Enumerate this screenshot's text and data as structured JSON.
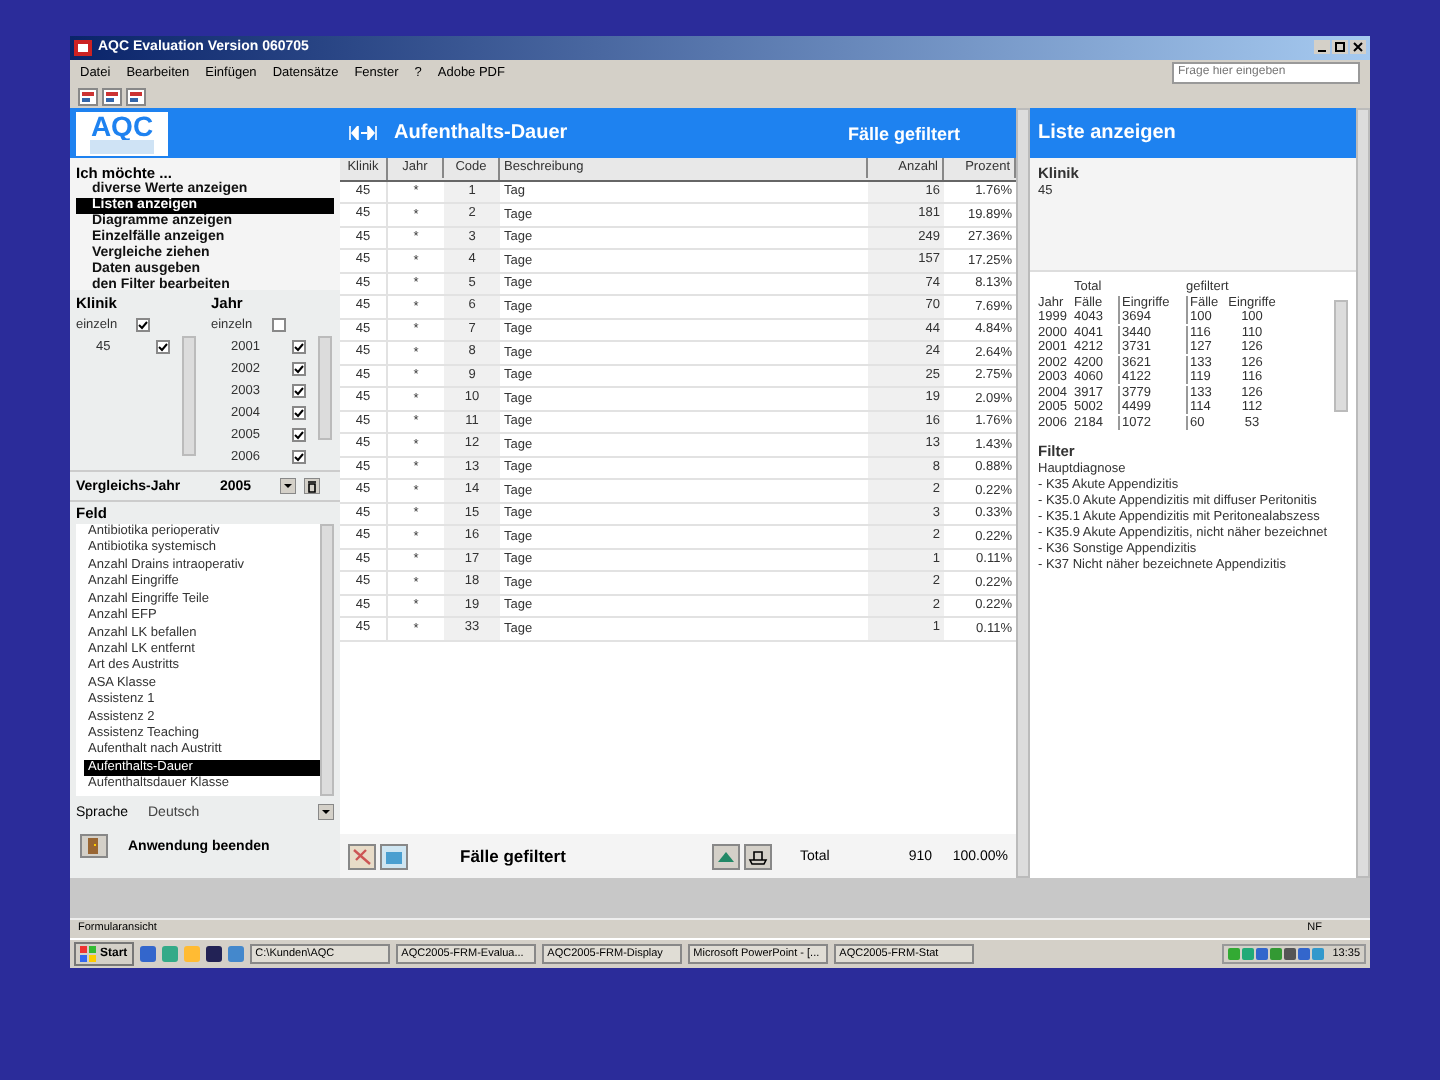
{
  "window": {
    "title": "AQC Evaluation Version 060705",
    "help_placeholder": "Frage hier eingeben"
  },
  "menu": [
    "Datei",
    "Bearbeiten",
    "Einfügen",
    "Datensätze",
    "Fenster",
    "?",
    "Adobe PDF"
  ],
  "left": {
    "logo": "AQC",
    "heading": "Ich möchte ...",
    "actions": [
      {
        "label": "diverse Werte anzeigen",
        "selected": false
      },
      {
        "label": "Listen anzeigen",
        "selected": true
      },
      {
        "label": "Diagramme anzeigen",
        "selected": false
      },
      {
        "label": "Einzelfälle anzeigen",
        "selected": false
      },
      {
        "label": "Vergleiche ziehen",
        "selected": false
      },
      {
        "label": "Daten ausgeben",
        "selected": false
      },
      {
        "label": "den Filter bearbeiten",
        "selected": false
      }
    ],
    "klinik": {
      "label": "Klinik",
      "einzeln_label": "einzeln",
      "einzeln_checked": true,
      "items": [
        {
          "label": "45",
          "checked": true
        }
      ]
    },
    "jahr": {
      "label": "Jahr",
      "einzeln_label": "einzeln",
      "einzeln_checked": false,
      "items": [
        {
          "label": "2001",
          "checked": true
        },
        {
          "label": "2002",
          "checked": true
        },
        {
          "label": "2003",
          "checked": true
        },
        {
          "label": "2004",
          "checked": true
        },
        {
          "label": "2005",
          "checked": true
        },
        {
          "label": "2006",
          "checked": true
        }
      ]
    },
    "vergleichsjahr": {
      "label": "Vergleichs-Jahr",
      "value": "2005"
    },
    "feld": {
      "label": "Feld",
      "items": [
        {
          "label": "Antibiotika perioperativ",
          "selected": false
        },
        {
          "label": "Antibiotika systemisch",
          "selected": false
        },
        {
          "label": "Anzahl Drains intraoperativ",
          "selected": false
        },
        {
          "label": "Anzahl Eingriffe",
          "selected": false
        },
        {
          "label": "Anzahl Eingriffe Teile",
          "selected": false
        },
        {
          "label": "Anzahl EFP",
          "selected": false
        },
        {
          "label": "Anzahl LK befallen",
          "selected": false
        },
        {
          "label": "Anzahl LK entfernt",
          "selected": false
        },
        {
          "label": "Art des Austritts",
          "selected": false
        },
        {
          "label": "ASA Klasse",
          "selected": false
        },
        {
          "label": "Assistenz 1",
          "selected": false
        },
        {
          "label": "Assistenz 2",
          "selected": false
        },
        {
          "label": "Assistenz Teaching",
          "selected": false
        },
        {
          "label": "Aufenthalt nach Austritt",
          "selected": false
        },
        {
          "label": "Aufenthalts-Dauer",
          "selected": true
        },
        {
          "label": "Aufenthaltsdauer Klasse",
          "selected": false
        }
      ]
    },
    "sprache": {
      "label": "Sprache",
      "value": "Deutsch"
    },
    "exit_label": "Anwendung beenden"
  },
  "center": {
    "title": "Aufenthalts-Dauer",
    "subtitle": "Fälle gefiltert",
    "columns": [
      "Klinik",
      "Jahr",
      "Code",
      "Beschreibung",
      "Anzahl",
      "Prozent"
    ],
    "rows": [
      [
        "45",
        "*",
        "1",
        "Tag",
        "16",
        "1.76%"
      ],
      [
        "45",
        "*",
        "2",
        "Tage",
        "181",
        "19.89%"
      ],
      [
        "45",
        "*",
        "3",
        "Tage",
        "249",
        "27.36%"
      ],
      [
        "45",
        "*",
        "4",
        "Tage",
        "157",
        "17.25%"
      ],
      [
        "45",
        "*",
        "5",
        "Tage",
        "74",
        "8.13%"
      ],
      [
        "45",
        "*",
        "6",
        "Tage",
        "70",
        "7.69%"
      ],
      [
        "45",
        "*",
        "7",
        "Tage",
        "44",
        "4.84%"
      ],
      [
        "45",
        "*",
        "8",
        "Tage",
        "24",
        "2.64%"
      ],
      [
        "45",
        "*",
        "9",
        "Tage",
        "25",
        "2.75%"
      ],
      [
        "45",
        "*",
        "10",
        "Tage",
        "19",
        "2.09%"
      ],
      [
        "45",
        "*",
        "11",
        "Tage",
        "16",
        "1.76%"
      ],
      [
        "45",
        "*",
        "12",
        "Tage",
        "13",
        "1.43%"
      ],
      [
        "45",
        "*",
        "13",
        "Tage",
        "8",
        "0.88%"
      ],
      [
        "45",
        "*",
        "14",
        "Tage",
        "2",
        "0.22%"
      ],
      [
        "45",
        "*",
        "15",
        "Tage",
        "3",
        "0.33%"
      ],
      [
        "45",
        "*",
        "16",
        "Tage",
        "2",
        "0.22%"
      ],
      [
        "45",
        "*",
        "17",
        "Tage",
        "1",
        "0.11%"
      ],
      [
        "45",
        "*",
        "18",
        "Tage",
        "2",
        "0.22%"
      ],
      [
        "45",
        "*",
        "19",
        "Tage",
        "2",
        "0.22%"
      ],
      [
        "45",
        "*",
        "33",
        "Tage",
        "1",
        "0.11%"
      ]
    ],
    "footer_title": "Fälle gefiltert",
    "total_label": "Total",
    "total_count": "910",
    "total_percent": "100.00%"
  },
  "right": {
    "title": "Liste anzeigen",
    "klinik_label": "Klinik",
    "klinik_value": "45",
    "group_headers": [
      "Total",
      "gefiltert"
    ],
    "columns": [
      "Jahr",
      "Fälle",
      "Eingriffe",
      "Fälle",
      "Eingriffe"
    ],
    "rows": [
      [
        "1999",
        "4043",
        "3694",
        "100",
        "100"
      ],
      [
        "2000",
        "4041",
        "3440",
        "116",
        "110"
      ],
      [
        "2001",
        "4212",
        "3731",
        "127",
        "126"
      ],
      [
        "2002",
        "4200",
        "3621",
        "133",
        "126"
      ],
      [
        "2003",
        "4060",
        "4122",
        "119",
        "116"
      ],
      [
        "2004",
        "3917",
        "3779",
        "133",
        "126"
      ],
      [
        "2005",
        "5002",
        "4499",
        "114",
        "112"
      ],
      [
        "2006",
        "2184",
        "1072",
        "60",
        "53"
      ]
    ],
    "filter_label": "Filter",
    "filter_lines": [
      "Hauptdiagnose",
      "- K35    Akute Appendizitis",
      "- K35.0    Akute Appendizitis mit diffuser Peritonitis",
      "- K35.1    Akute Appendizitis mit Peritonealabszess",
      "- K35.9    Akute Appendizitis, nicht näher bezeichnet",
      "- K36    Sonstige Appendizitis",
      "- K37    Nicht näher bezeichnete Appendizitis"
    ]
  },
  "status_bar": {
    "text": "Formularansicht",
    "indicator": "NF"
  },
  "taskbar": {
    "start": "Start",
    "tasks": [
      "C:\\Kunden\\AQC",
      "AQC2005-FRM-Evalua...",
      "AQC2005-FRM-Display",
      "Microsoft PowerPoint - [...",
      "AQC2005-FRM-Stat"
    ],
    "clock": "13:35"
  }
}
